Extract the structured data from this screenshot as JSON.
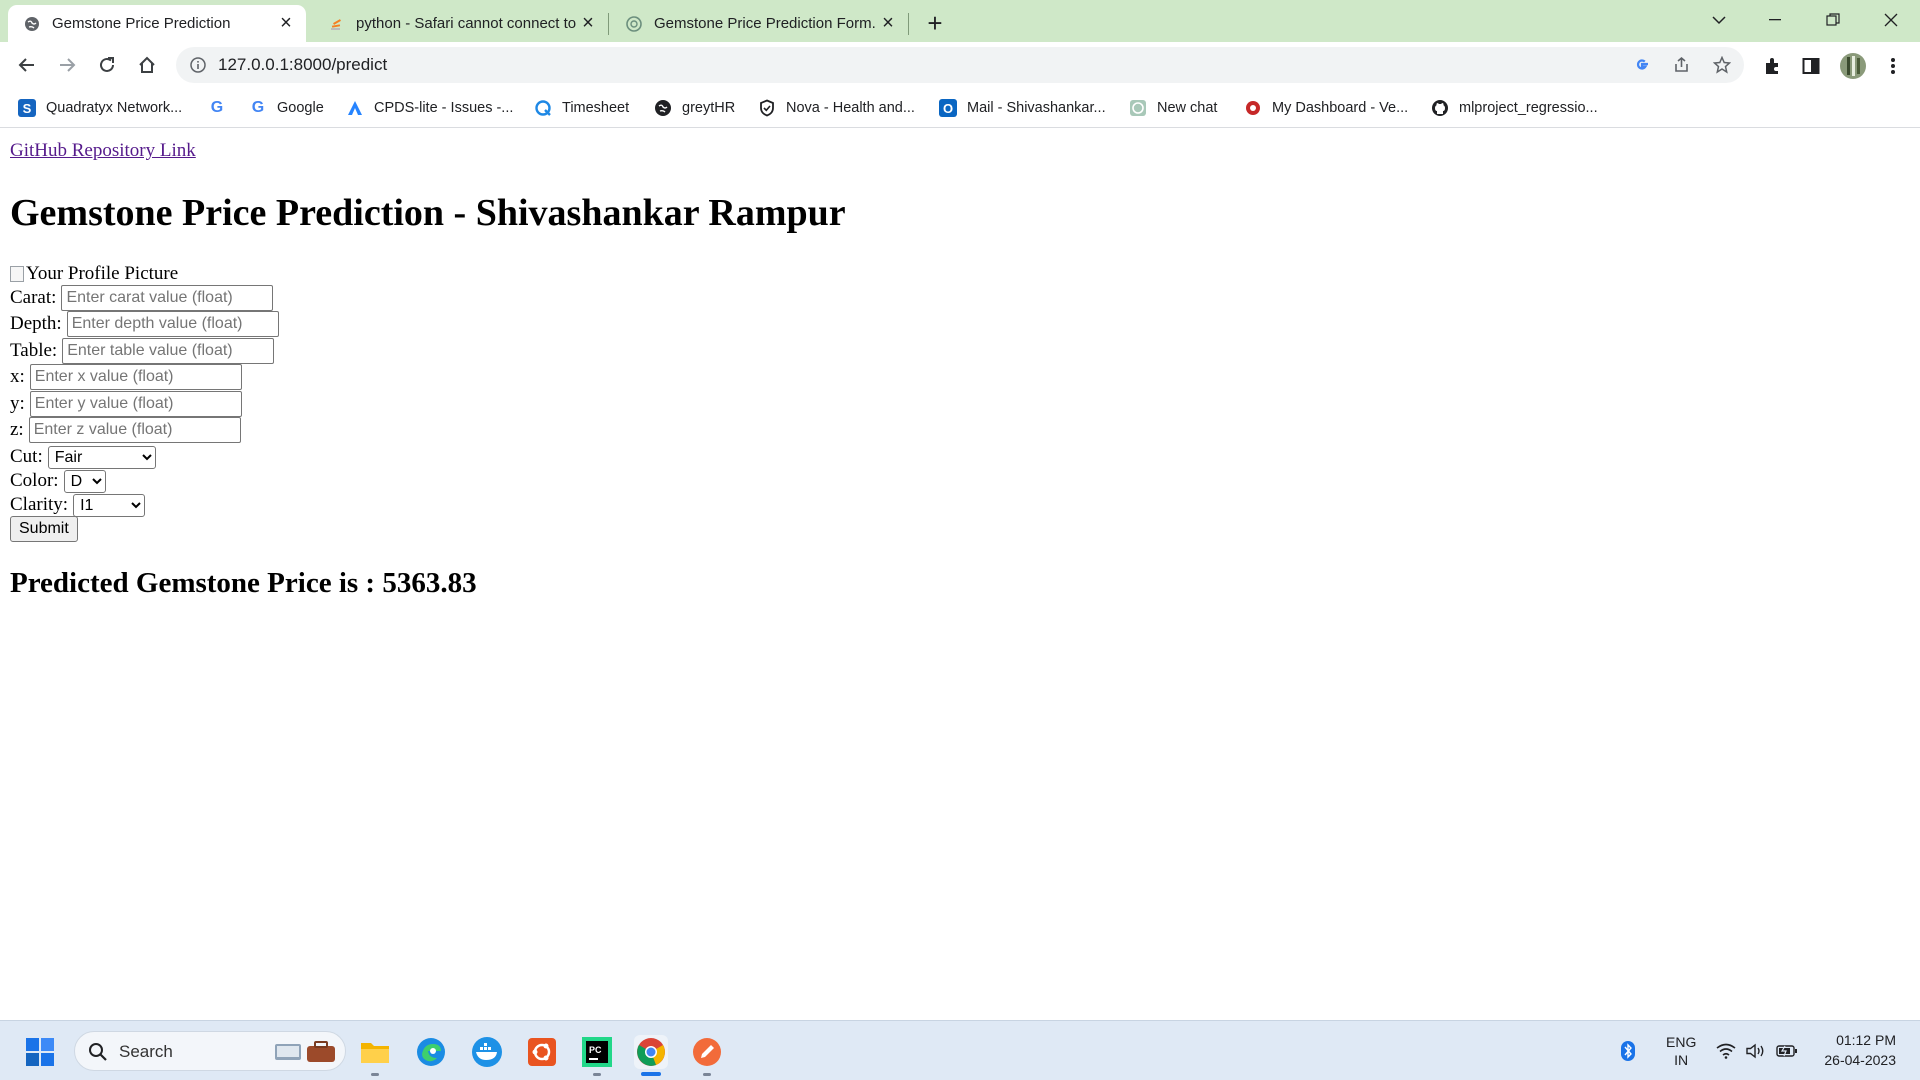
{
  "browser": {
    "tabs": [
      {
        "title": "Gemstone Price Prediction",
        "active": true,
        "icon": "globe-icon"
      },
      {
        "title": "python - Safari cannot connect to",
        "active": false,
        "icon": "stackoverflow-icon"
      },
      {
        "title": "Gemstone Price Prediction Form.",
        "active": false,
        "icon": "chatgpt-icon"
      }
    ],
    "url": "127.0.0.1:8000/predict",
    "bookmarks": [
      {
        "label": "Quadratyx Network...",
        "icon": "s-icon",
        "color": "#1565c0"
      },
      {
        "label": "",
        "icon": "google-icon",
        "color": "#4285f4"
      },
      {
        "label": "Google",
        "icon": "google-icon",
        "color": "#4285f4"
      },
      {
        "label": "CPDS-lite - Issues -...",
        "icon": "jira-icon",
        "color": "#2684ff"
      },
      {
        "label": "Timesheet",
        "icon": "q-icon",
        "color": "#1e88e5"
      },
      {
        "label": "greytHR",
        "icon": "globe-icon",
        "color": "#202124"
      },
      {
        "label": "Nova - Health and...",
        "icon": "shield-icon",
        "color": "#202124"
      },
      {
        "label": "Mail - Shivashankar...",
        "icon": "outlook-icon",
        "color": "#0a66c2"
      },
      {
        "label": "New chat",
        "icon": "chatgpt-icon",
        "color": "#10a37f"
      },
      {
        "label": "My Dashboard - Ve...",
        "icon": "dashboard-icon",
        "color": "#c62828"
      },
      {
        "label": "mlproject_regressio...",
        "icon": "github-icon",
        "color": "#202124"
      }
    ]
  },
  "page": {
    "repo_link": "GitHub Repository Link",
    "heading": "Gemstone Price Prediction - Shivashankar Rampur",
    "image_alt": "Your Profile Picture",
    "fields": {
      "carat": {
        "label": "Carat:",
        "placeholder": "Enter carat value (float)"
      },
      "depth": {
        "label": "Depth:",
        "placeholder": "Enter depth value (float)"
      },
      "table": {
        "label": "Table:",
        "placeholder": "Enter table value (float)"
      },
      "x": {
        "label": "x:",
        "placeholder": "Enter x value (float)"
      },
      "y": {
        "label": "y:",
        "placeholder": "Enter y value (float)"
      },
      "z": {
        "label": "z:",
        "placeholder": "Enter z value (float)"
      }
    },
    "selects": {
      "cut": {
        "label": "Cut:",
        "value": "Fair"
      },
      "color": {
        "label": "Color:",
        "value": "D"
      },
      "clarity": {
        "label": "Clarity:",
        "value": "I1"
      }
    },
    "submit_label": "Submit",
    "result": "Predicted Gemstone Price is : 5363.83"
  },
  "taskbar": {
    "search_label": "Search",
    "apps": [
      "windows-start-icon",
      "file-explorer-icon",
      "edge-icon",
      "docker-icon",
      "ubuntu-icon",
      "pycharm-icon",
      "chrome-icon",
      "pen-app-icon"
    ],
    "language_line1": "ENG",
    "language_line2": "IN",
    "time": "01:12 PM",
    "date": "26-04-2023"
  }
}
